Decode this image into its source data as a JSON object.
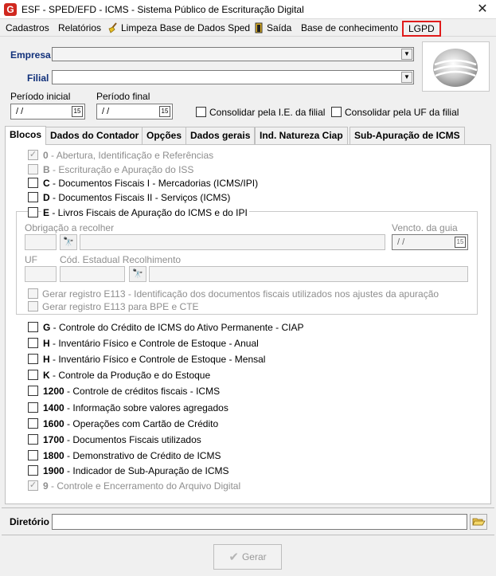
{
  "window": {
    "title": "ESF - SPED/EFD - ICMS - Sistema Público de Escrituração Digital",
    "close_glyph": "✕",
    "app_icon": "G"
  },
  "menu": {
    "items": [
      "Cadastros",
      "Relatórios",
      "Limpeza Base de Dados Sped",
      "Saída",
      "Base de conhecimento",
      "LGPD"
    ]
  },
  "form": {
    "empresa_label": "Empresa",
    "filial_label": "Filial",
    "periodo_inicial_label": "Período inicial",
    "periodo_final_label": "Período final",
    "periodo_inicial_value": "/ /",
    "periodo_final_value": "/ /",
    "calendar_glyph": "15",
    "consolidar_ie_label": "Consolidar pela I.E. da filial",
    "consolidar_uf_label": "Consolidar pela UF da filial"
  },
  "tabs": [
    "Blocos",
    "Dados do Contador",
    "Opções",
    "Dados gerais",
    "Ind. Natureza Ciap",
    "Sub-Apuração de ICMS"
  ],
  "blocos": [
    {
      "code": "0",
      "text": " - Abertura, Identificação e Referências",
      "checked": true,
      "disabled": true
    },
    {
      "code": "B",
      "text": " - Escrituração e Apuração do ISS",
      "checked": false,
      "disabled": true
    },
    {
      "code": "C",
      "text": " - Documentos Fiscais I - Mercadorias (ICMS/IPI)",
      "checked": false,
      "disabled": false
    },
    {
      "code": "D",
      "text": " - Documentos Fiscais II - Serviços (ICMS)",
      "checked": false,
      "disabled": false
    }
  ],
  "bloco_e": {
    "code": "E",
    "text": " - Livros Fiscais de Apuração do ICMS e do IPI",
    "obrigacao_label": "Obrigação a recolher",
    "vencto_label": "Vencto. da guia",
    "vencto_value": "/ /",
    "uf_label": "UF",
    "cod_estadual_label": "Cód. Estadual Recolhimento",
    "e113_label": "Gerar registro E113 - Identificação dos documentos fiscais utilizados nos ajustes da apuração",
    "e113_bpe_label": "Gerar registro E113 para BPE e CTE"
  },
  "blocos_2": [
    {
      "code": "G",
      "text": " - Controle do Crédito de ICMS do Ativo Permanente - CIAP",
      "checked": false,
      "disabled": false
    },
    {
      "code": "H",
      "text": " - Inventário Físico e Controle de Estoque - Anual",
      "checked": false,
      "disabled": false
    },
    {
      "code": "H",
      "text": " - Inventário Físico e Controle de Estoque - Mensal",
      "checked": false,
      "disabled": false
    },
    {
      "code": "K",
      "text": " - Controle da Produção e do Estoque",
      "checked": false,
      "disabled": false
    },
    {
      "code": "1200",
      "text": " - Controle de créditos fiscais - ICMS",
      "checked": false,
      "disabled": false
    },
    {
      "code": "1400",
      "text": " - Informação sobre valores agregados",
      "checked": false,
      "disabled": false
    },
    {
      "code": "1600",
      "text": " - Operações com Cartão de Crédito",
      "checked": false,
      "disabled": false
    },
    {
      "code": "1700",
      "text": " - Documentos Fiscais utilizados",
      "checked": false,
      "disabled": false
    },
    {
      "code": "1800",
      "text": " - Demonstrativo de Crédito de ICMS",
      "checked": false,
      "disabled": false
    },
    {
      "code": "1900",
      "text": " - Indicador de Sub-Apuração de ICMS",
      "checked": false,
      "disabled": false
    },
    {
      "code": "9",
      "text": " - Controle e Encerramento do Arquivo Digital",
      "checked": true,
      "disabled": true
    }
  ],
  "footer": {
    "diretorio_label": "Diretório",
    "gerar_label": "Gerar"
  }
}
